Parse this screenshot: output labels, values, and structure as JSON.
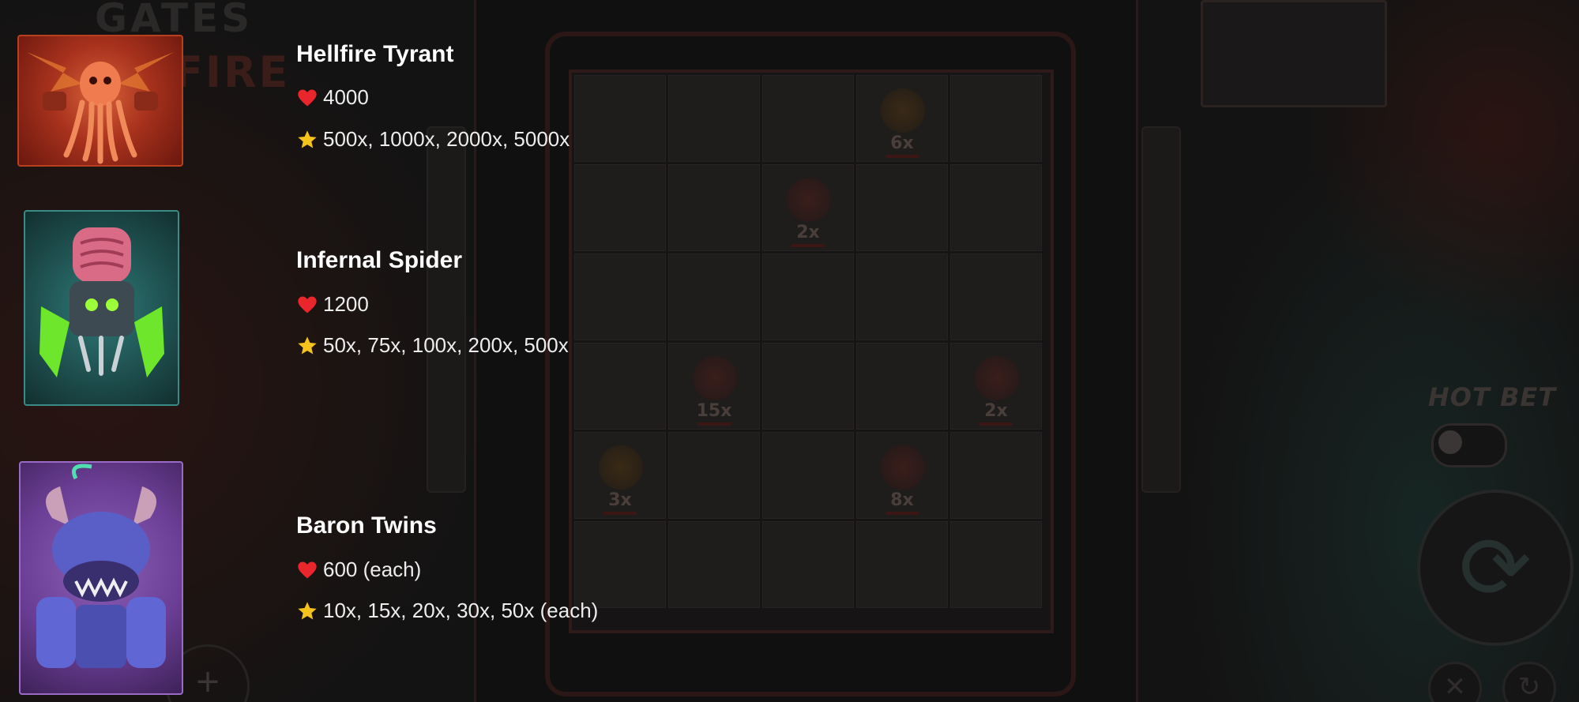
{
  "game": {
    "logo_text": "GATES",
    "logo_text_2": "FIRE",
    "hot_bet_label": "HOT BET"
  },
  "board": {
    "cells": [
      "",
      "",
      "",
      "6x",
      "",
      "",
      "",
      "2x",
      "",
      "",
      "",
      "",
      "",
      "",
      "",
      "",
      "15x",
      "",
      "",
      "2x",
      "3x",
      "",
      "",
      "8x",
      "",
      "",
      "",
      "",
      "",
      ""
    ]
  },
  "monsters": [
    {
      "name": "Hellfire Tyrant",
      "health": "4000",
      "multipliers": "500x, 1000x, 2000x, 5000x",
      "icon": "hellfire-tyrant-portrait",
      "card_color": "#a8321d"
    },
    {
      "name": "Infernal Spider",
      "health": "1200",
      "multipliers": "50x, 75x, 100x, 200x, 500x",
      "icon": "infernal-spider-portrait",
      "card_color": "#1d4d4c"
    },
    {
      "name": "Baron Twins",
      "health": "600 (each)",
      "multipliers": "10x, 15x, 20x, 30x, 50x (each)",
      "icon": "baron-twins-portrait",
      "card_color": "#6b3e95"
    }
  ],
  "icons": {
    "health": "heart-icon",
    "multiplier": "star-icon",
    "spin": "spin-icon"
  },
  "colors": {
    "heart": "#e8262b",
    "star": "#f6c21c",
    "text": "#ffffff"
  }
}
